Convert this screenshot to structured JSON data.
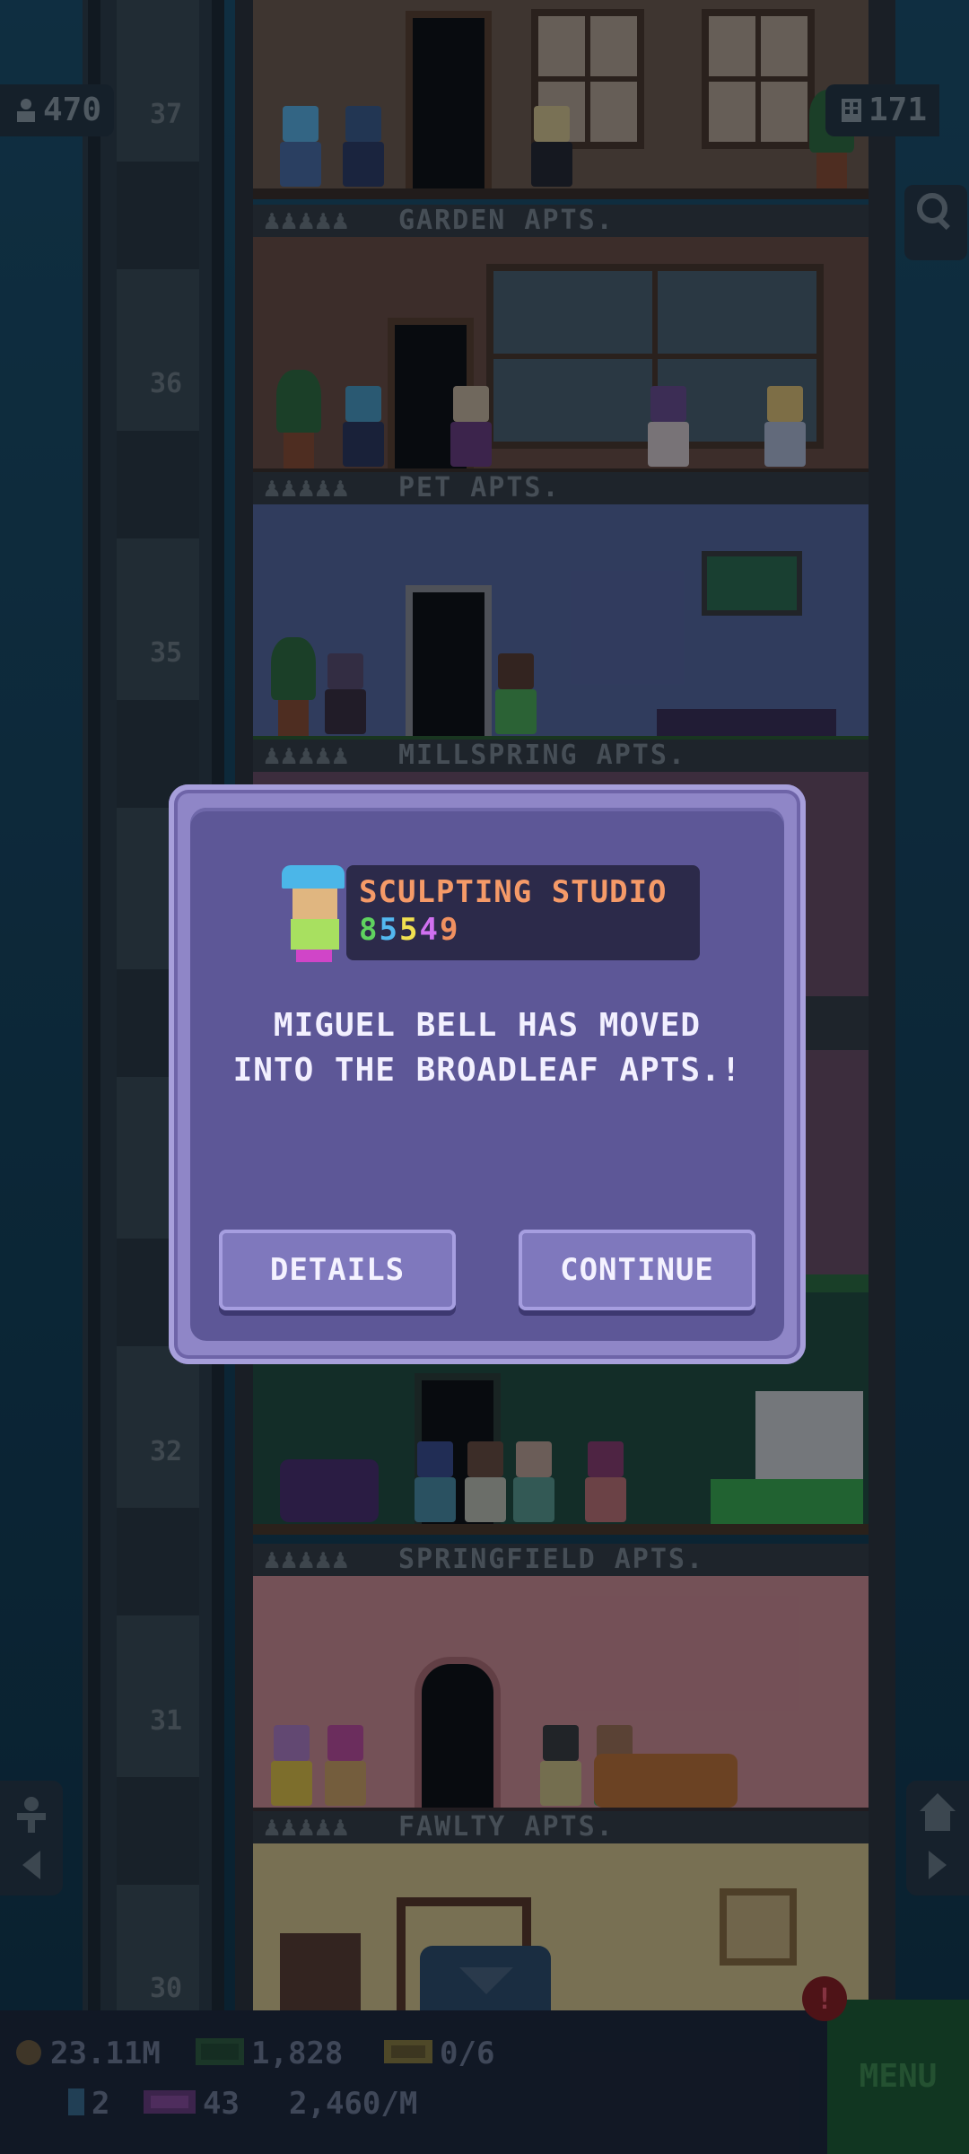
{
  "top": {
    "population": "470",
    "floors": "171"
  },
  "floors": [
    {
      "number": "37",
      "label": "GARDEN APTS.",
      "dots": "♟♟♟♟♟"
    },
    {
      "number": "36",
      "label": "PET APTS.",
      "dots": "♟♟♟♟♟"
    },
    {
      "number": "35",
      "label": "MILLSPRING APTS.",
      "dots": "♟♟♟♟♟"
    },
    {
      "number": "32",
      "label": "SPRINGFIELD APTS.",
      "dots": "♟♟♟♟♟"
    },
    {
      "number": "31",
      "label": "FAWLTY APTS.",
      "dots": "♟♟♟♟♟"
    },
    {
      "number": "30",
      "label": "",
      "dots": ""
    }
  ],
  "dialog": {
    "job_title": "SCULPTING STUDIO",
    "skills": [
      "8",
      "5",
      "5",
      "4",
      "9"
    ],
    "skill_colors": [
      "#5fd25f",
      "#53b8f0",
      "#f0e050",
      "#d070f0",
      "#f09060"
    ],
    "message_line1": "MIGUEL BELL HAS MOVED",
    "message_line2": "INTO THE BROADLEAF APTS.!",
    "details_label": "DETAILS",
    "continue_label": "CONTINUE"
  },
  "bottom": {
    "coins": "23.11M",
    "bux": "1,828",
    "tickets": "0/6",
    "elevators": "2",
    "vip": "43",
    "rate": "2,460/M",
    "menu_label": "MENU",
    "alert": "!"
  },
  "icons": {
    "population": "person-icon",
    "floors": "building-icon",
    "search": "magnifier-icon",
    "left_nav": "person-arrow-icon",
    "right_nav": "home-arrow-icon"
  }
}
